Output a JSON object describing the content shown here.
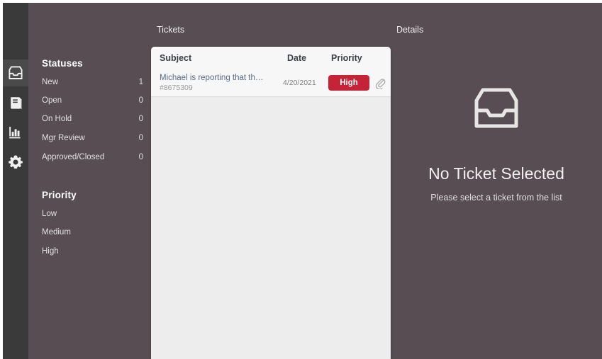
{
  "theme": {
    "app_bg": "#574d52",
    "rail_bg": "#3b3a3a",
    "rail_active_bg": "#4b4a4a",
    "panel_bg": "#ededed",
    "row_bg": "#f7f7f7",
    "accent_high": "#c62338",
    "subject_link": "#5a6b87"
  },
  "rail": {
    "items": [
      {
        "icon": "inbox-icon",
        "name": "inbox",
        "active": true
      },
      {
        "icon": "book-icon",
        "name": "knowledge-base",
        "active": false
      },
      {
        "icon": "bar-chart-icon",
        "name": "reports",
        "active": false
      },
      {
        "icon": "gear-icon",
        "name": "settings",
        "active": false
      }
    ]
  },
  "sidebar": {
    "statuses_heading": "Statuses",
    "statuses": [
      {
        "label": "New",
        "count": "1"
      },
      {
        "label": "Open",
        "count": "0"
      },
      {
        "label": "On Hold",
        "count": "0"
      },
      {
        "label": "Mgr Review",
        "count": "0"
      },
      {
        "label": "Approved/Closed",
        "count": "0"
      }
    ],
    "priority_heading": "Priority",
    "priorities": [
      {
        "label": "Low"
      },
      {
        "label": "Medium"
      },
      {
        "label": "High"
      }
    ]
  },
  "captions": {
    "tickets": "Tickets",
    "details": "Details"
  },
  "ticket_list": {
    "columns": {
      "subject": "Subject",
      "date": "Date",
      "priority": "Priority"
    },
    "rows": [
      {
        "subject": "Michael is reporting that th…",
        "id": "#8675309",
        "date": "4/20/2021",
        "priority": "High",
        "priority_color": "#c62338",
        "attachment": "paperclip-icon"
      }
    ]
  },
  "details_panel": {
    "empty_icon": "inbox-icon",
    "empty_title": "No Ticket Selected",
    "empty_subtitle": "Please select a ticket from the list"
  }
}
